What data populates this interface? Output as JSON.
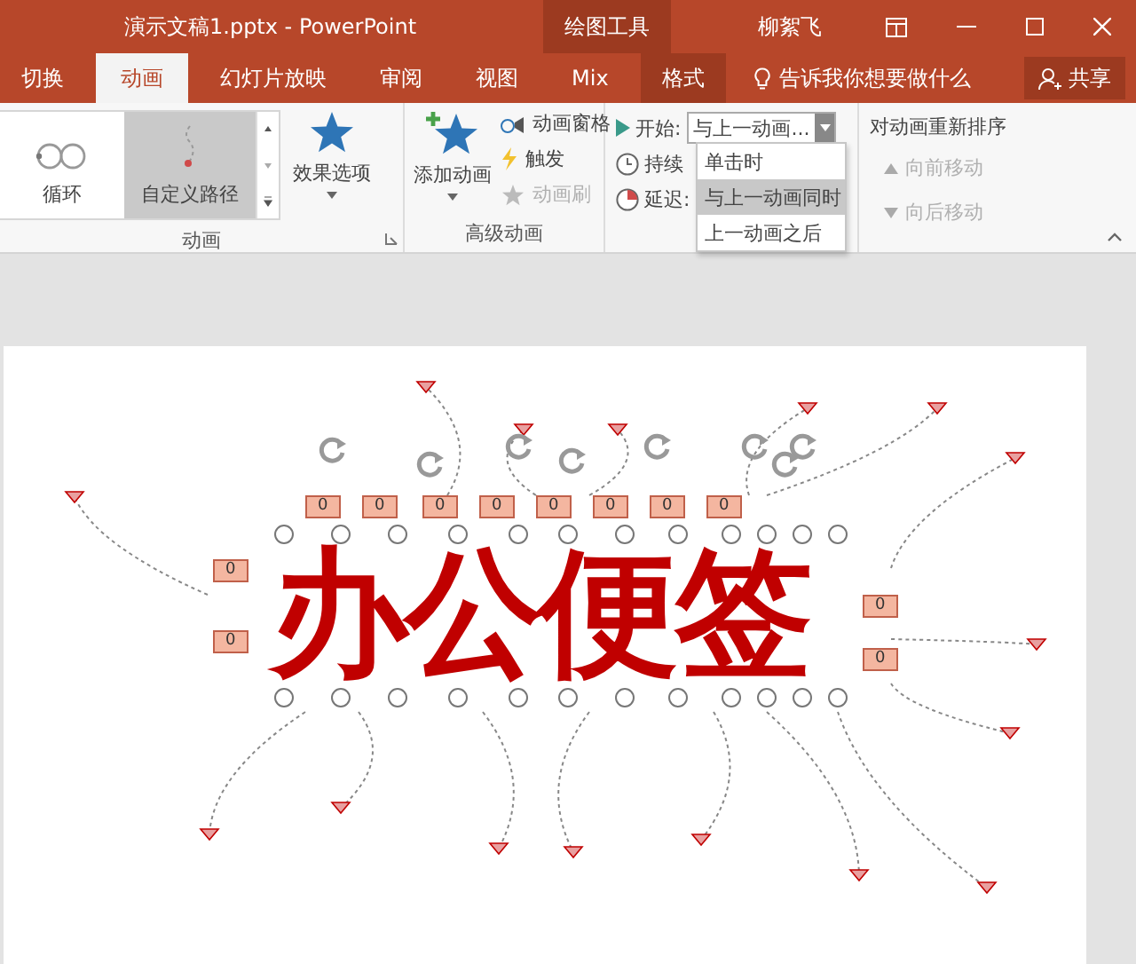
{
  "window": {
    "title": "演示文稿1.pptx - PowerPoint",
    "context_group": "绘图工具",
    "user": "柳絮飞"
  },
  "tabs": [
    {
      "label": "切换",
      "selected": false,
      "contextual": false
    },
    {
      "label": "动画",
      "selected": true,
      "contextual": false
    },
    {
      "label": "幻灯片放映",
      "selected": false,
      "contextual": false
    },
    {
      "label": "审阅",
      "selected": false,
      "contextual": false
    },
    {
      "label": "视图",
      "selected": false,
      "contextual": false
    },
    {
      "label": "Mix",
      "selected": false,
      "contextual": false
    },
    {
      "label": "格式",
      "selected": false,
      "contextual": true
    }
  ],
  "tell_me": {
    "placeholder": "告诉我你想要做什么"
  },
  "share_button": "共享",
  "ribbon": {
    "animation_group": {
      "label": "动画",
      "gallery": [
        {
          "label": "循环",
          "selected": false
        },
        {
          "label": "自定义路径",
          "selected": true
        }
      ],
      "effect_options": "效果选项"
    },
    "advanced_group": {
      "label": "高级动画",
      "add_animation": "添加动画",
      "commands": [
        {
          "label": "动画窗格",
          "disabled": false
        },
        {
          "label": "触发",
          "disabled": false
        },
        {
          "label": "动画刷",
          "disabled": true
        }
      ]
    },
    "timing": {
      "start_label": "开始:",
      "start_value": "与上一动画...",
      "duration_label": "持续",
      "delay_label": "延迟:",
      "options": [
        {
          "label": "单击时",
          "selected": false
        },
        {
          "label": "与上一动画同时",
          "selected": true
        },
        {
          "label": "上一动画之后",
          "selected": false
        }
      ]
    },
    "reorder": {
      "title": "对动画重新排序",
      "commands": [
        {
          "label": "向前移动",
          "disabled": true
        },
        {
          "label": "向后移动",
          "disabled": true
        }
      ]
    }
  },
  "slide": {
    "text": "办公便签",
    "tags": [
      "0",
      "0",
      "0",
      "0",
      "0",
      "0",
      "0",
      "0",
      "0",
      "0",
      "0",
      "0"
    ]
  }
}
